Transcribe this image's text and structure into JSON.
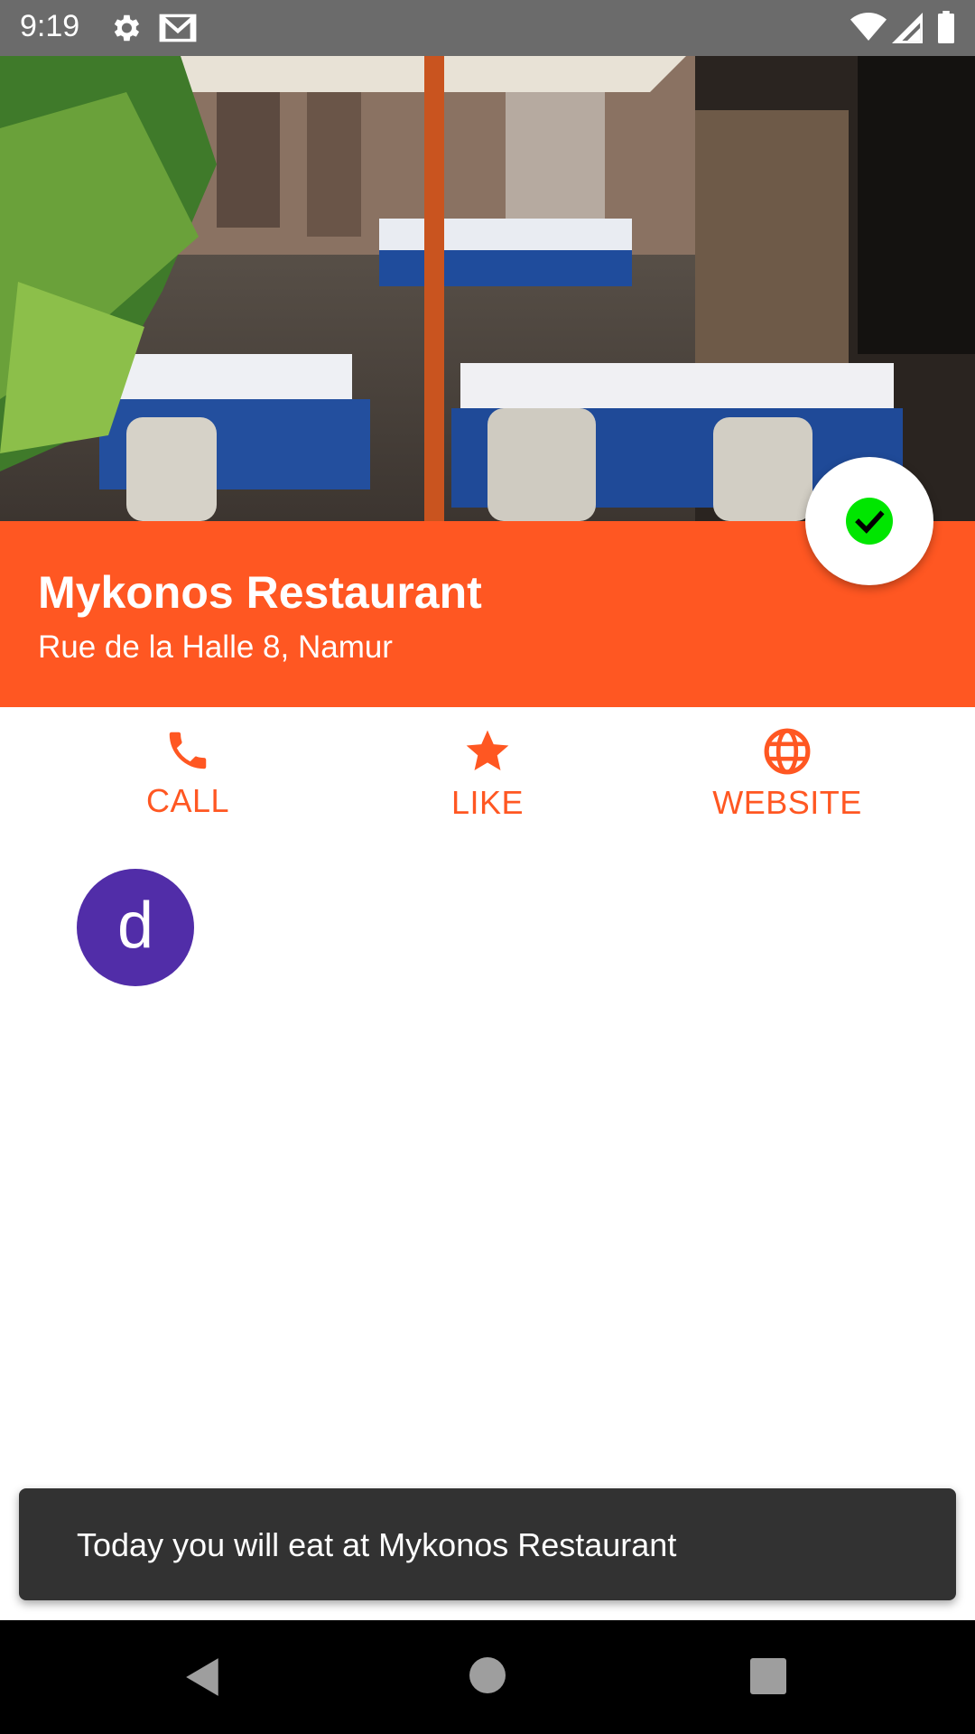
{
  "status_bar": {
    "time": "9:19",
    "icons": [
      "gear-icon",
      "gmail-icon",
      "wifi-icon",
      "signal-icon",
      "battery-icon"
    ]
  },
  "hero": {
    "image": "restaurant-terrace-photo"
  },
  "restaurant": {
    "name": "Mykonos Restaurant",
    "address": "Rue de la Halle 8, Namur"
  },
  "fab": {
    "icon": "check-circle-icon",
    "icon_color": "#00e600"
  },
  "actions": [
    {
      "label": "CALL",
      "icon": "phone-icon"
    },
    {
      "label": "LIKE",
      "icon": "star-icon"
    },
    {
      "label": "WEBSITE",
      "icon": "globe-icon"
    }
  ],
  "avatar": {
    "letter": "d",
    "color": "#512da8"
  },
  "snackbar": {
    "message": "Today you will eat at Mykonos Restaurant"
  },
  "nav_bar": {
    "icons": [
      "back-icon",
      "home-icon",
      "recents-icon"
    ]
  },
  "colors": {
    "accent": "#ff5722",
    "status_bar": "#6b6b6b",
    "snackbar": "#323232"
  }
}
